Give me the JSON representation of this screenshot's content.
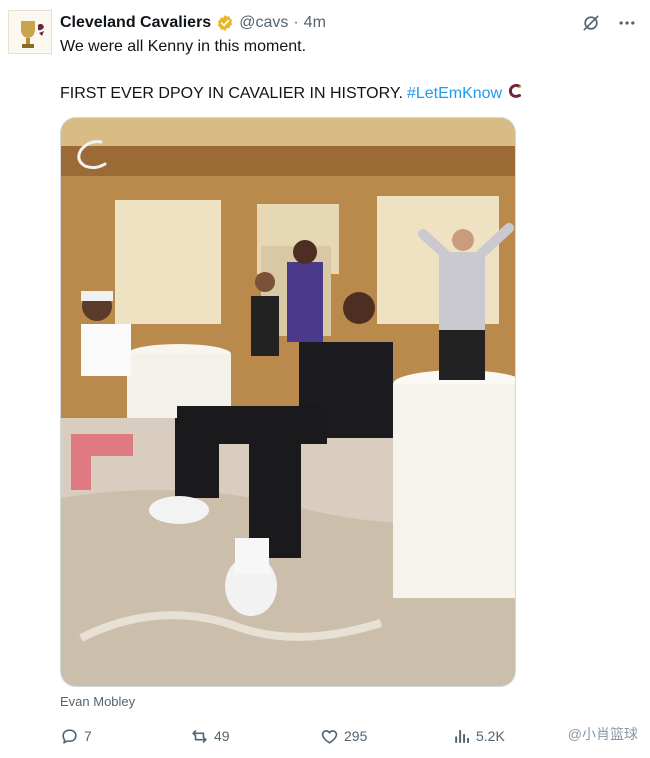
{
  "post": {
    "author_name": "Cleveland Cavaliers",
    "handle": "@cavs",
    "separator": "·",
    "time": "4m",
    "line1": "We were all Kenny in this moment.",
    "line2_text": "FIRST EVER DPOY IN CAVALIER IN HISTORY.",
    "hashtag": "#LetEmKnow",
    "tagged_user": "Evan Mobley"
  },
  "metrics": {
    "replies": "7",
    "reposts": "49",
    "likes": "295",
    "views": "5.2K"
  },
  "watermark": "@小肖篮球",
  "icons": {
    "verified": "verified-badge-icon",
    "grok": "grok-icon",
    "more": "more-icon",
    "reply": "reply-icon",
    "repost": "repost-icon",
    "like": "heart-icon",
    "views": "views-icon"
  },
  "colors": {
    "text": "#0f1419",
    "secondary": "#536471",
    "link": "#1d9bf0",
    "verified": "#e8b82a",
    "brand_wine": "#6f263d"
  }
}
